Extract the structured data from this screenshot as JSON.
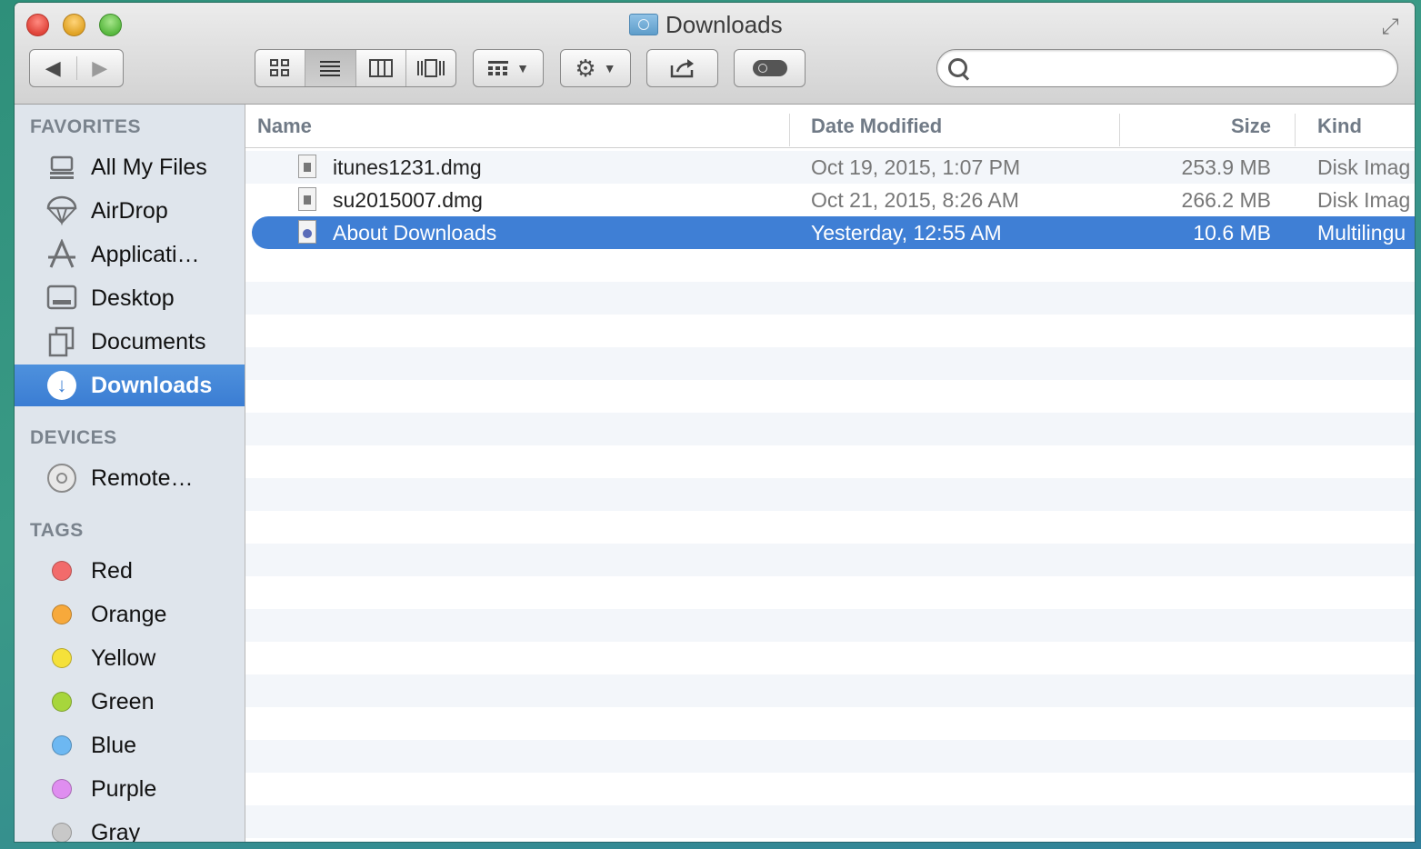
{
  "window": {
    "title": "Downloads"
  },
  "toolbar": {
    "back_label": "◀",
    "forward_label": "▶",
    "view_icons": [
      "icon-view-icon",
      "list-view-icon",
      "column-view-icon",
      "cover-flow-icon"
    ],
    "search": {
      "value": "",
      "placeholder": ""
    }
  },
  "sidebar": {
    "favorites_header": "FAVORITES",
    "favorites": [
      {
        "label": "All My Files",
        "icon": "all-files-icon"
      },
      {
        "label": "AirDrop",
        "icon": "airdrop-icon"
      },
      {
        "label": "Applicati…",
        "icon": "applications-icon"
      },
      {
        "label": "Desktop",
        "icon": "desktop-icon"
      },
      {
        "label": "Documents",
        "icon": "documents-icon"
      },
      {
        "label": "Downloads",
        "icon": "downloads-icon",
        "selected": true
      }
    ],
    "devices_header": "DEVICES",
    "devices": [
      {
        "label": "Remote…",
        "icon": "disc-icon"
      }
    ],
    "tags_header": "TAGS",
    "tags": [
      {
        "label": "Red",
        "color": "#f26b6b"
      },
      {
        "label": "Orange",
        "color": "#f7a93b"
      },
      {
        "label": "Yellow",
        "color": "#f5e13a"
      },
      {
        "label": "Green",
        "color": "#a7d63c"
      },
      {
        "label": "Blue",
        "color": "#6db8f2"
      },
      {
        "label": "Purple",
        "color": "#df8ef0"
      },
      {
        "label": "Gray",
        "color": "#c8c8c8"
      }
    ]
  },
  "list": {
    "headers": {
      "name": "Name",
      "date": "Date Modified",
      "size": "Size",
      "kind": "Kind"
    },
    "files": [
      {
        "name": "itunes1231.dmg",
        "date": "Oct 19, 2015, 1:07 PM",
        "size": "253.9 MB",
        "kind": "Disk Imag"
      },
      {
        "name": "su2015007.dmg",
        "date": "Oct 21, 2015, 8:26 AM",
        "size": "266.2 MB",
        "kind": "Disk Imag"
      },
      {
        "name": "About Downloads",
        "date": "Yesterday, 12:55 AM",
        "size": "10.6 MB",
        "kind": "Multilingu",
        "selected": true
      }
    ]
  },
  "colors": {
    "selection": "#3f7fd5",
    "sidebar_bg": "#dfe5ec",
    "stripe": "#f3f6fa"
  }
}
